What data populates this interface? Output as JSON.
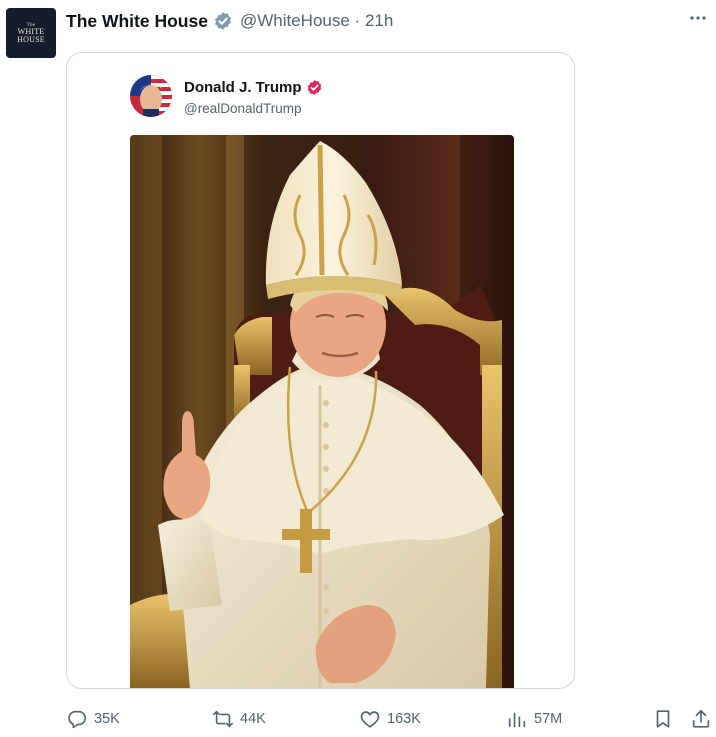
{
  "tweet": {
    "author": {
      "display_name": "The White House",
      "handle": "@WhiteHouse",
      "separator": "·",
      "time": "21h",
      "avatar_text": {
        "line1": "The",
        "line2": "WHITE",
        "line3": "HOUSE"
      }
    },
    "more_icon": "more-horizontal-icon"
  },
  "embed": {
    "display_name": "Donald J. Trump",
    "handle": "@realDonaldTrump",
    "badge_color": "#e0245e",
    "image_alt": "AI-generated image of Donald Trump dressed as the Pope, seated on a gilded throne, raising his right index finger"
  },
  "actions": {
    "reply": {
      "count": "35K",
      "icon": "reply-icon"
    },
    "repost": {
      "count": "44K",
      "icon": "repost-icon"
    },
    "like": {
      "count": "163K",
      "icon": "heart-icon"
    },
    "views": {
      "count": "57M",
      "icon": "views-chart-icon"
    },
    "bookmark": {
      "icon": "bookmark-icon"
    },
    "share": {
      "icon": "share-icon"
    }
  },
  "colors": {
    "text_primary": "#0f1419",
    "text_secondary": "#536471",
    "card_border": "#cfd9de",
    "gov_badge": "#829aab",
    "avatar_bg": "#141c2e"
  }
}
